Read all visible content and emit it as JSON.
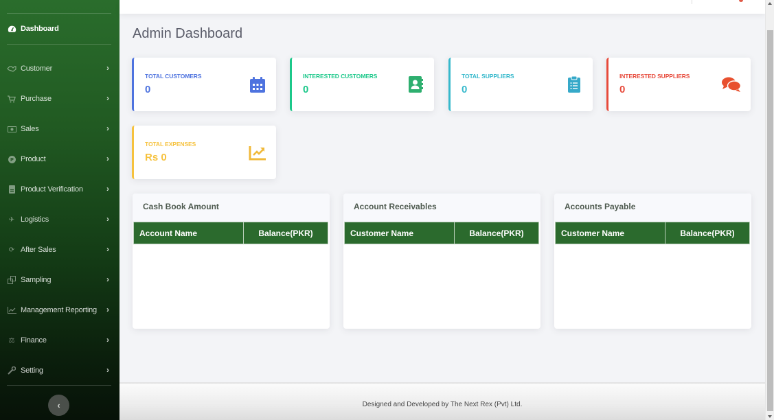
{
  "sidebar": {
    "active": {
      "label": "Dashboard",
      "icon": "tachometer-icon"
    },
    "items": [
      {
        "label": "Customer",
        "icon": "handshake-icon"
      },
      {
        "label": "Purchase",
        "icon": "cart-icon"
      },
      {
        "label": "Sales",
        "icon": "money-bill-icon"
      },
      {
        "label": "Product",
        "icon": "product-circle-icon"
      },
      {
        "label": "Product Verification",
        "icon": "id-badge-icon"
      },
      {
        "label": "Logistics",
        "icon": "plane-icon"
      },
      {
        "label": "After Sales",
        "icon": "sync-icon"
      },
      {
        "label": "Sampling",
        "icon": "clone-icon"
      },
      {
        "label": "Management Reporting",
        "icon": "chart-line-icon"
      },
      {
        "label": "Finance",
        "icon": "balance-scale-icon"
      },
      {
        "label": "Setting",
        "icon": "wrench-icon"
      }
    ],
    "chevron": "›",
    "toggle_label": "‹"
  },
  "page": {
    "title": "Admin Dashboard"
  },
  "stats": [
    {
      "label": "Total Customers",
      "value": "0",
      "color": "#4e73df",
      "icon": "calendar-icon"
    },
    {
      "label": "Interested Customers",
      "value": "0",
      "color": "#1cc88a",
      "icon": "address-book-icon"
    },
    {
      "label": "Total Suppliers",
      "value": "0",
      "color": "#36b9cc",
      "icon": "clipboard-list-icon"
    },
    {
      "label": "Interested Suppliers",
      "value": "0",
      "color": "#e74a3b",
      "icon": "comments-icon"
    },
    {
      "label": "Total Expenses",
      "value": "Rs 0",
      "color": "#f6c23e",
      "icon": "chart-area-icon"
    }
  ],
  "panels": [
    {
      "title": "Cash Book Amount",
      "columns": [
        "Account Name",
        "Balance(PKR)"
      ],
      "rows": []
    },
    {
      "title": "Account Receivables",
      "columns": [
        "Customer Name",
        "Balance(PKR)"
      ],
      "rows": []
    },
    {
      "title": "Accounts Payable",
      "columns": [
        "Customer Name",
        "Balance(PKR)"
      ],
      "rows": []
    }
  ],
  "footer": {
    "text": "Designed and Developed by The Next Rex (Pvt) Ltd."
  },
  "colors": {
    "brand_green": "#2b6a2d"
  }
}
